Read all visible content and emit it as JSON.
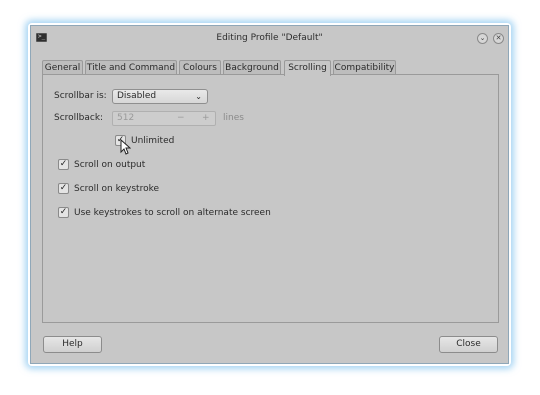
{
  "window": {
    "title": "Editing Profile \"Default\"",
    "minimize_glyph": "⌄",
    "close_glyph": "✕",
    "app_icon_glyph": ">_"
  },
  "tabs": [
    {
      "label": "General",
      "active": false
    },
    {
      "label": "Title and Command",
      "active": false
    },
    {
      "label": "Colours",
      "active": false
    },
    {
      "label": "Background",
      "active": false
    },
    {
      "label": "Scrolling",
      "active": true
    },
    {
      "label": "Compatibility",
      "active": false
    }
  ],
  "scrolling": {
    "scrollbar_label": "Scrollbar is:",
    "scrollbar_value": "Disabled",
    "scrollback_label": "Scrollback:",
    "scrollback_value": "512",
    "scrollback_units": "lines",
    "unlimited_label": "Unlimited",
    "unlimited_checked": true,
    "scroll_on_output_label": "Scroll on output",
    "scroll_on_output_checked": true,
    "scroll_on_keystroke_label": "Scroll on keystroke",
    "scroll_on_keystroke_checked": true,
    "alt_screen_label": "Use keystrokes to scroll on alternate screen",
    "alt_screen_checked": true
  },
  "buttons": {
    "help": "Help",
    "close": "Close"
  },
  "icons": {
    "check": "✓",
    "dropdown": "chevron-down-icon",
    "minus": "−",
    "plus": "+"
  }
}
